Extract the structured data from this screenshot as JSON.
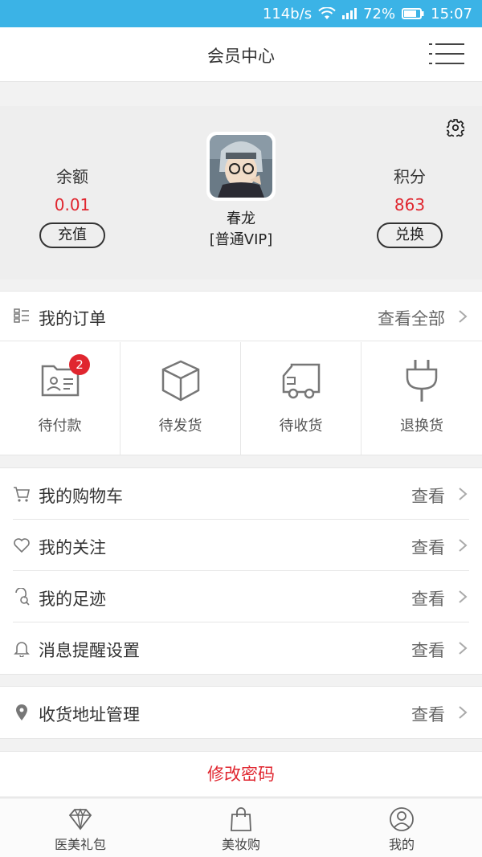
{
  "status_bar": {
    "speed": "114b/s",
    "battery": "72%",
    "time": "15:07"
  },
  "header": {
    "title": "会员中心"
  },
  "profile": {
    "balance_label": "余额",
    "balance_value": "0.01",
    "recharge_button": "充值",
    "points_label": "积分",
    "points_value": "863",
    "exchange_button": "兑换",
    "user_name": "春龙",
    "user_level": "[普通VIP]"
  },
  "orders": {
    "title": "我的订单",
    "view_all": "查看全部",
    "tabs": [
      {
        "label": "待付款",
        "badge": "2"
      },
      {
        "label": "待发货"
      },
      {
        "label": "待收货"
      },
      {
        "label": "退换货"
      }
    ]
  },
  "menu_group": [
    {
      "label": "我的购物车",
      "action": "查看"
    },
    {
      "label": "我的关注",
      "action": "查看"
    },
    {
      "label": "我的足迹",
      "action": "查看"
    },
    {
      "label": "消息提醒设置",
      "action": "查看"
    }
  ],
  "address": {
    "label": "收货地址管理",
    "action": "查看"
  },
  "change_password": "修改密码",
  "tabbar": [
    {
      "label": "医美礼包"
    },
    {
      "label": "美妆购"
    },
    {
      "label": "我的"
    }
  ],
  "colors": {
    "status_bar": "#3bb3e6",
    "accent_red": "#e0262f"
  }
}
